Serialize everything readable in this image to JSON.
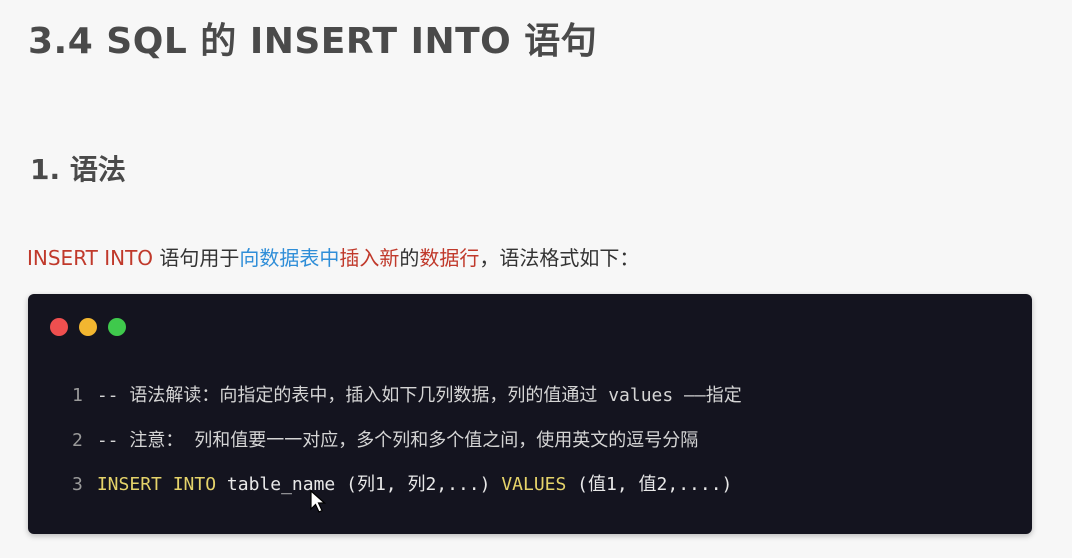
{
  "section_title": "3.4 SQL 的 INSERT INTO 语句",
  "subsection_title": "1. 语法",
  "intro": {
    "part1": "INSERT INTO",
    "part2": " 语句用于",
    "part3": "向数据表中",
    "part4": "插入新",
    "part5": "的",
    "part6": "数据行",
    "part7": "，语法格式如下："
  },
  "code": {
    "window_dots": [
      "red",
      "yellow",
      "green"
    ],
    "lines": [
      {
        "number": "1",
        "text": "-- 语法解读：向指定的表中，插入如下几列数据，列的值通过 values ——指定"
      },
      {
        "number": "2",
        "text": "-- 注意：  列和值要一一对应，多个列和多个值之间，使用英文的逗号分隔"
      },
      {
        "number": "3",
        "kw1": "INSERT INTO",
        "mid": " table_name (列1, 列2,...) ",
        "kw2": "VALUES",
        "tail": " (值1, 值2,....)"
      }
    ]
  },
  "colors": {
    "keyword_red": "#c0392b",
    "keyword_blue": "#2f8ed8",
    "code_bg": "#14141f",
    "code_keyword": "#e5d36a"
  }
}
